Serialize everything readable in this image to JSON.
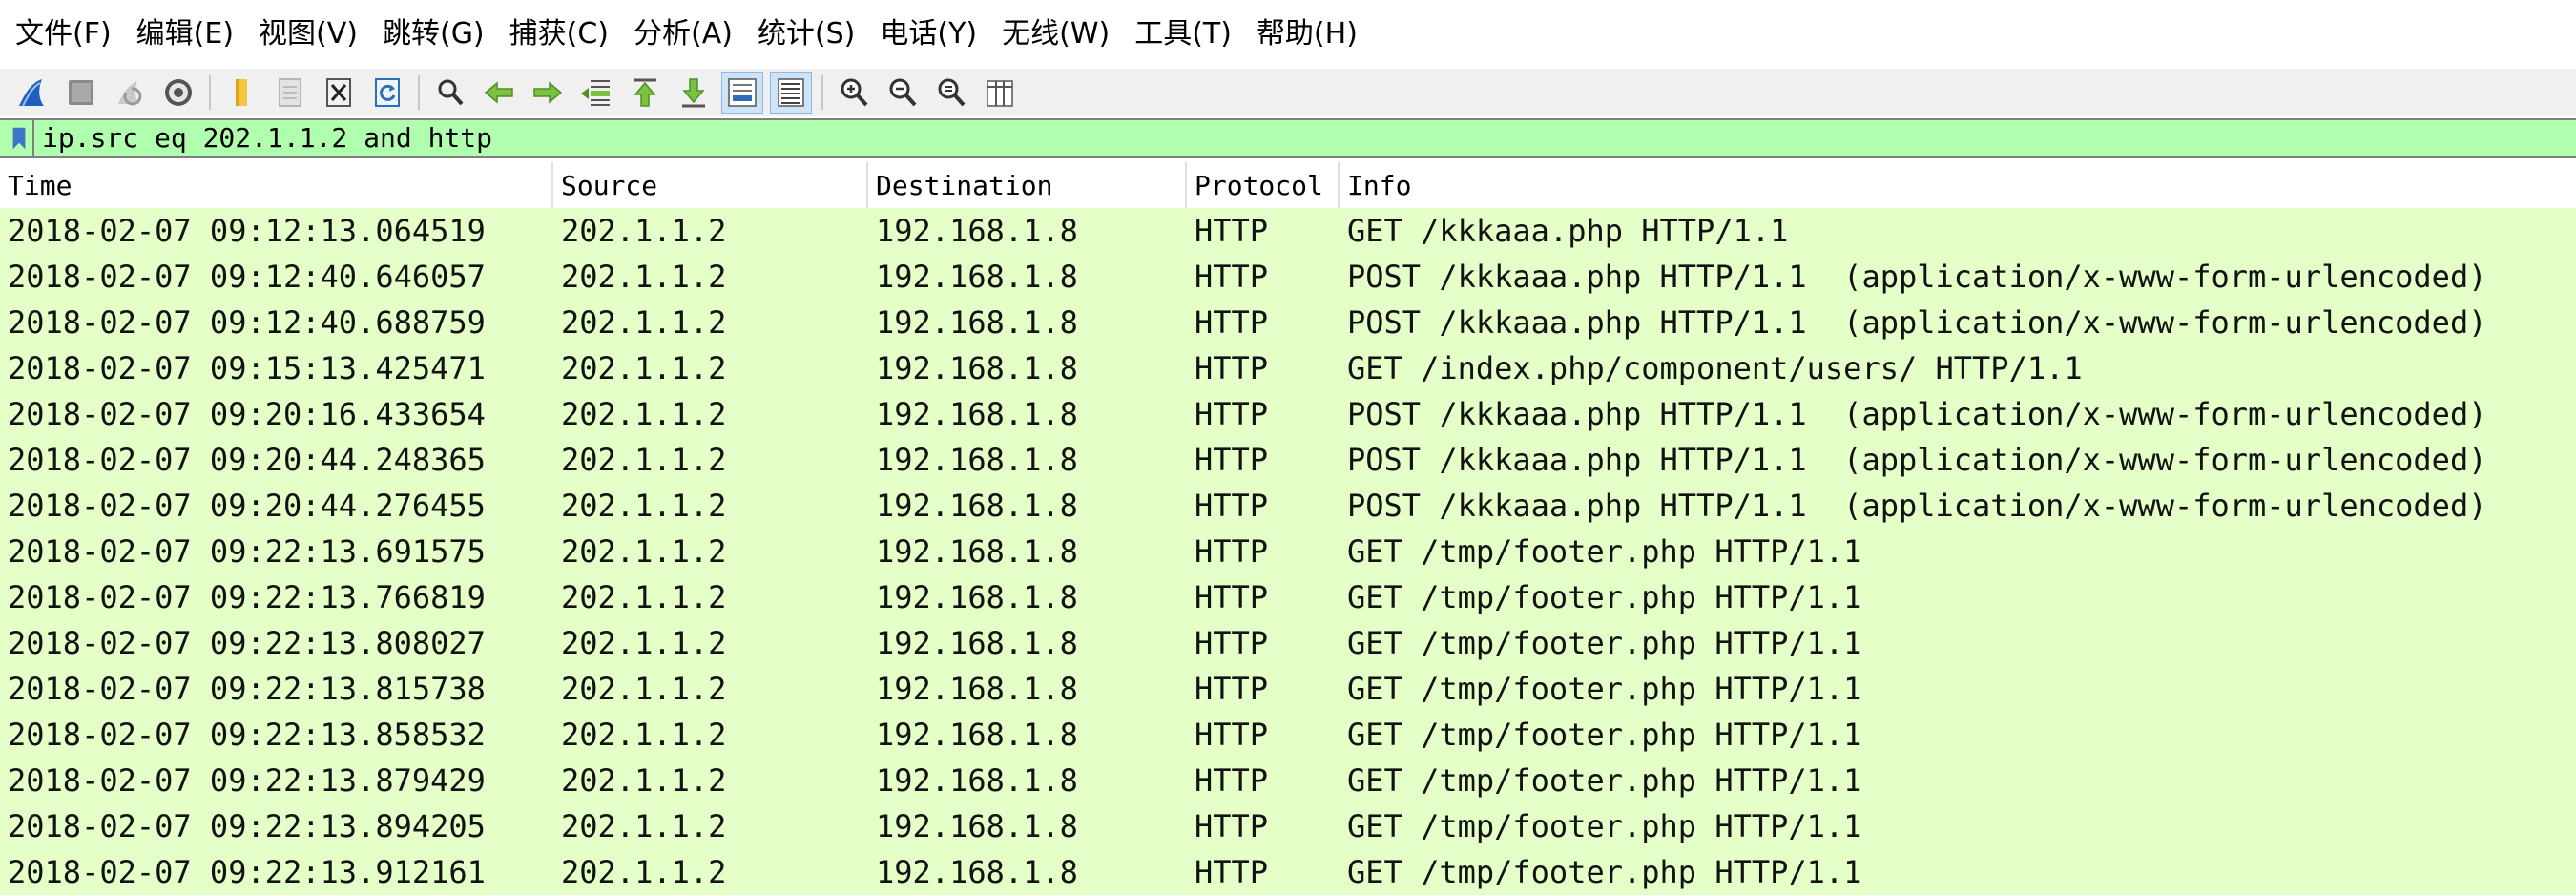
{
  "menubar": {
    "items": [
      {
        "label": "文件(F)"
      },
      {
        "label": "编辑(E)"
      },
      {
        "label": "视图(V)"
      },
      {
        "label": "跳转(G)"
      },
      {
        "label": "捕获(C)"
      },
      {
        "label": "分析(A)"
      },
      {
        "label": "统计(S)"
      },
      {
        "label": "电话(Y)"
      },
      {
        "label": "无线(W)"
      },
      {
        "label": "工具(T)"
      },
      {
        "label": "帮助(H)"
      }
    ]
  },
  "toolbar": {
    "icons": [
      "start-capture-icon",
      "stop-capture-icon",
      "restart-capture-icon",
      "capture-options-icon",
      "open-file-icon",
      "save-file-icon",
      "close-file-icon",
      "reload-file-icon",
      "find-packet-icon",
      "go-back-icon",
      "go-forward-icon",
      "go-to-packet-icon",
      "go-first-packet-icon",
      "go-last-packet-icon",
      "auto-scroll-icon",
      "colorize-icon",
      "zoom-in-icon",
      "zoom-out-icon",
      "normal-size-icon",
      "resize-columns-icon"
    ]
  },
  "filter": {
    "value": "ip.src eq 202.1.1.2 and http",
    "color": "#afffaf"
  },
  "packet_list": {
    "columns": [
      "Time",
      "Source",
      "Destination",
      "Protocol",
      "Info"
    ],
    "row_color": "#e4ffc7",
    "rows": [
      {
        "time": "2018-02-07 09:12:13.064519",
        "source": "202.1.1.2",
        "destination": "192.168.1.8",
        "protocol": "HTTP",
        "info": "GET /kkkaaa.php HTTP/1.1"
      },
      {
        "time": "2018-02-07 09:12:40.646057",
        "source": "202.1.1.2",
        "destination": "192.168.1.8",
        "protocol": "HTTP",
        "info": "POST /kkkaaa.php HTTP/1.1  (application/x-www-form-urlencoded)"
      },
      {
        "time": "2018-02-07 09:12:40.688759",
        "source": "202.1.1.2",
        "destination": "192.168.1.8",
        "protocol": "HTTP",
        "info": "POST /kkkaaa.php HTTP/1.1  (application/x-www-form-urlencoded)"
      },
      {
        "time": "2018-02-07 09:15:13.425471",
        "source": "202.1.1.2",
        "destination": "192.168.1.8",
        "protocol": "HTTP",
        "info": "GET /index.php/component/users/ HTTP/1.1"
      },
      {
        "time": "2018-02-07 09:20:16.433654",
        "source": "202.1.1.2",
        "destination": "192.168.1.8",
        "protocol": "HTTP",
        "info": "POST /kkkaaa.php HTTP/1.1  (application/x-www-form-urlencoded)"
      },
      {
        "time": "2018-02-07 09:20:44.248365",
        "source": "202.1.1.2",
        "destination": "192.168.1.8",
        "protocol": "HTTP",
        "info": "POST /kkkaaa.php HTTP/1.1  (application/x-www-form-urlencoded)"
      },
      {
        "time": "2018-02-07 09:20:44.276455",
        "source": "202.1.1.2",
        "destination": "192.168.1.8",
        "protocol": "HTTP",
        "info": "POST /kkkaaa.php HTTP/1.1  (application/x-www-form-urlencoded)"
      },
      {
        "time": "2018-02-07 09:22:13.691575",
        "source": "202.1.1.2",
        "destination": "192.168.1.8",
        "protocol": "HTTP",
        "info": "GET /tmp/footer.php HTTP/1.1"
      },
      {
        "time": "2018-02-07 09:22:13.766819",
        "source": "202.1.1.2",
        "destination": "192.168.1.8",
        "protocol": "HTTP",
        "info": "GET /tmp/footer.php HTTP/1.1"
      },
      {
        "time": "2018-02-07 09:22:13.808027",
        "source": "202.1.1.2",
        "destination": "192.168.1.8",
        "protocol": "HTTP",
        "info": "GET /tmp/footer.php HTTP/1.1"
      },
      {
        "time": "2018-02-07 09:22:13.815738",
        "source": "202.1.1.2",
        "destination": "192.168.1.8",
        "protocol": "HTTP",
        "info": "GET /tmp/footer.php HTTP/1.1"
      },
      {
        "time": "2018-02-07 09:22:13.858532",
        "source": "202.1.1.2",
        "destination": "192.168.1.8",
        "protocol": "HTTP",
        "info": "GET /tmp/footer.php HTTP/1.1"
      },
      {
        "time": "2018-02-07 09:22:13.879429",
        "source": "202.1.1.2",
        "destination": "192.168.1.8",
        "protocol": "HTTP",
        "info": "GET /tmp/footer.php HTTP/1.1"
      },
      {
        "time": "2018-02-07 09:22:13.894205",
        "source": "202.1.1.2",
        "destination": "192.168.1.8",
        "protocol": "HTTP",
        "info": "GET /tmp/footer.php HTTP/1.1"
      },
      {
        "time": "2018-02-07 09:22:13.912161",
        "source": "202.1.1.2",
        "destination": "192.168.1.8",
        "protocol": "HTTP",
        "info": "GET /tmp/footer.php HTTP/1.1"
      }
    ]
  }
}
